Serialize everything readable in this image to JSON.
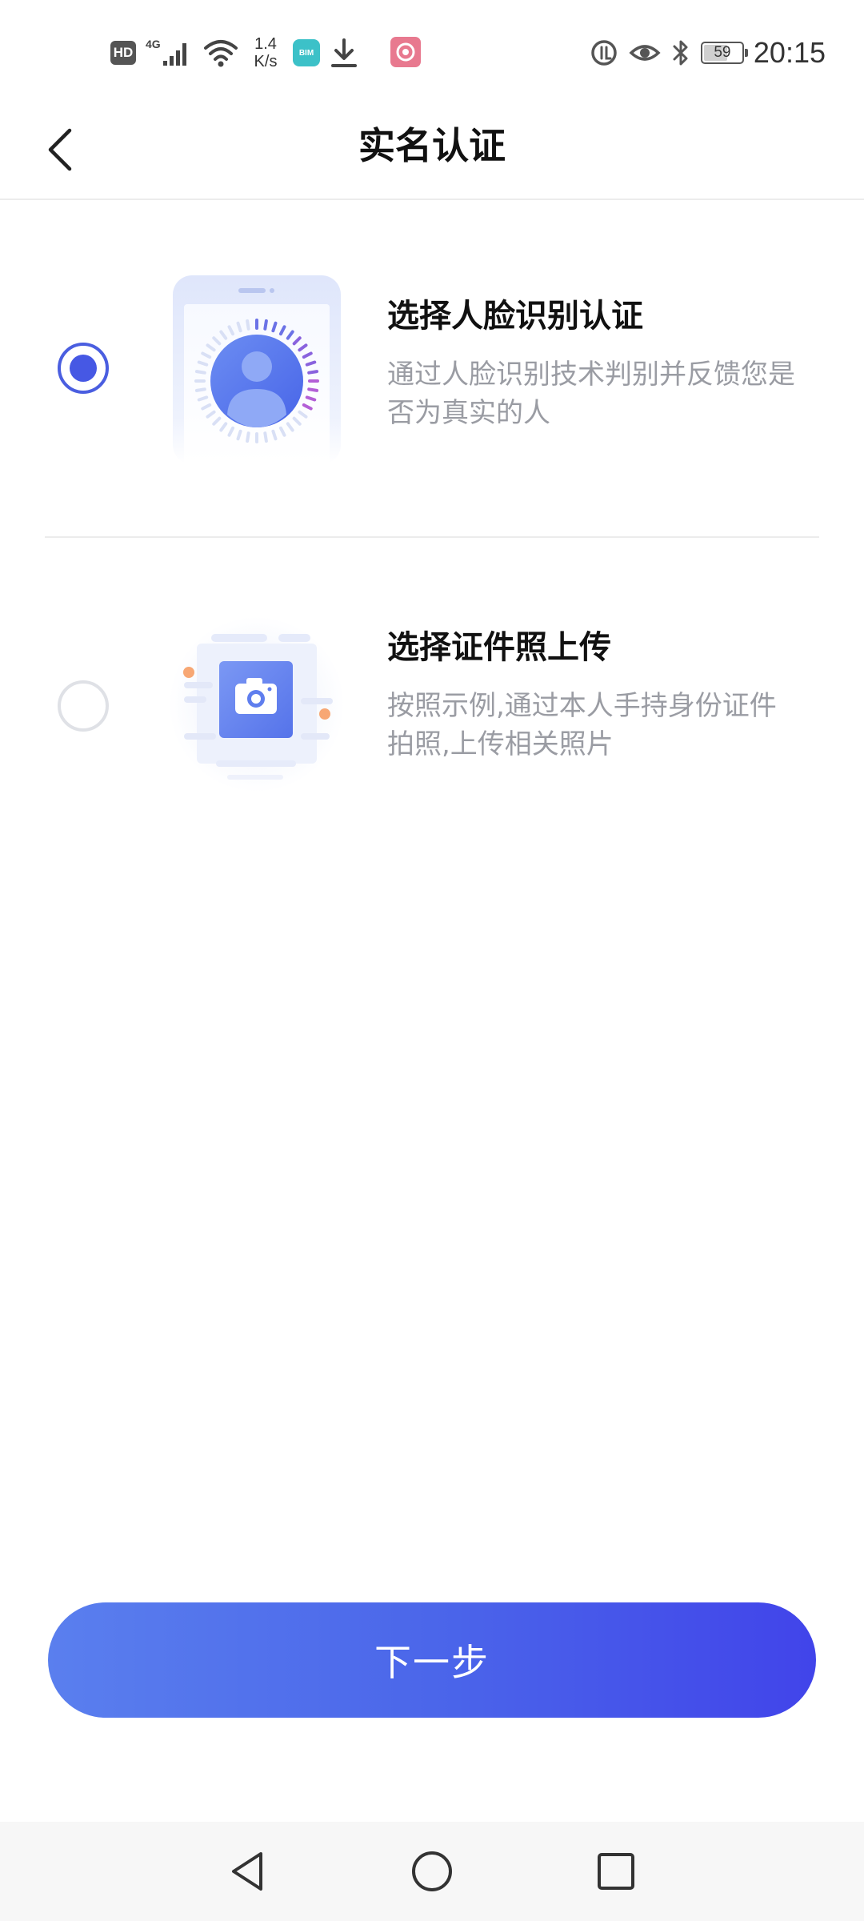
{
  "status_bar": {
    "hd_label": "HD",
    "network_label": "4G",
    "speed_value": "1.4",
    "speed_unit": "K/s",
    "app_badge_label": "BIM",
    "battery_level": "59",
    "time": "20:15",
    "icons": [
      "hd-icon",
      "signal-icon",
      "wifi-icon",
      "app-icon",
      "download-icon",
      "pink-app-icon",
      "data-saver-icon",
      "eye-icon",
      "bluetooth-icon",
      "battery-icon"
    ]
  },
  "header": {
    "title": "实名认证",
    "back_icon": "chevron-left-icon"
  },
  "options": [
    {
      "title": "选择人脸识别认证",
      "description": "通过人脸识别技术判别并反馈您是否为真实的人",
      "selected": true,
      "illustration": "face-recognition-icon"
    },
    {
      "title": "选择证件照上传",
      "description": "按照示例,通过本人手持身份证件拍照,上传相关照片",
      "selected": false,
      "illustration": "camera-icon"
    }
  ],
  "next_button": {
    "label": "下一步"
  },
  "nav_bar": {
    "icons": [
      "nav-back-icon",
      "nav-home-icon",
      "nav-recent-icon"
    ]
  },
  "colors": {
    "accent": "#4658e4",
    "button_start": "#5a7fee",
    "button_end": "#4144ea",
    "desc_text": "#9a9ca3",
    "divider": "#ececec"
  }
}
